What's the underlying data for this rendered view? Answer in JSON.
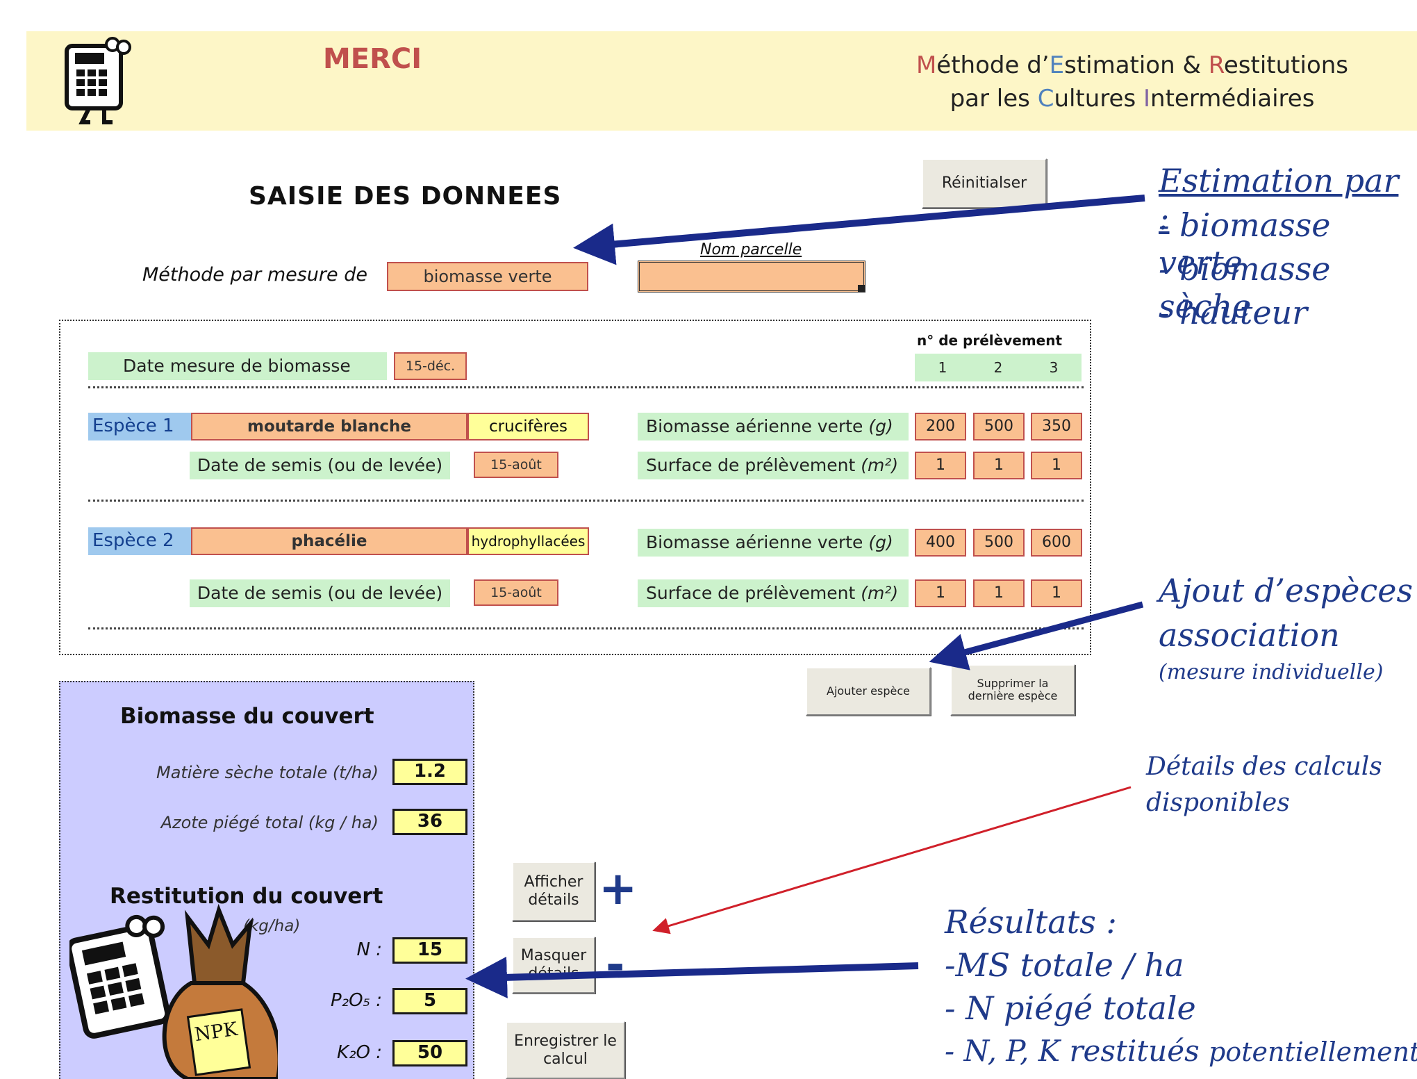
{
  "header": {
    "app_name": "MERCI",
    "subtitle_parts": [
      "M",
      "éthode d’",
      "E",
      "stimation & ",
      "R",
      "estitutions"
    ],
    "subtitle_line2_parts": [
      "par les ",
      "C",
      "ultures ",
      "I",
      "ntermédiaires"
    ]
  },
  "form": {
    "title": "SAISIE DES DONNEES",
    "reset_label": "Réinitialser",
    "method_label": "Méthode par mesure de",
    "method_value": "biomasse verte",
    "parcel_label": "Nom parcelle",
    "parcel_value": "",
    "date_biomass_label": "Date mesure de biomasse",
    "date_biomass_value": "15-déc.",
    "sample_header": "n° de prélèvement",
    "sample_numbers": [
      "1",
      "2",
      "3"
    ],
    "species": [
      {
        "label": "Espèce 1",
        "name": "moutarde blanche",
        "family": "crucifères",
        "sowing_label": "Date de semis (ou de levée)",
        "sowing_date": "15-août",
        "biomass_label": "Biomasse aérienne verte",
        "biomass_unit": "(g)",
        "biomass_values": [
          "200",
          "500",
          "350"
        ],
        "surface_label": "Surface de prélèvement",
        "surface_unit": "(m²)",
        "surface_values": [
          "1",
          "1",
          "1"
        ]
      },
      {
        "label": "Espèce 2",
        "name": "phacélie",
        "family": "hydrophyllacées",
        "sowing_label": "Date de semis (ou de levée)",
        "sowing_date": "15-août",
        "biomass_label": "Biomasse aérienne verte",
        "biomass_unit": "(g)",
        "biomass_values": [
          "400",
          "500",
          "600"
        ],
        "surface_label": "Surface de prélèvement",
        "surface_unit": "(m²)",
        "surface_values": [
          "1",
          "1",
          "1"
        ]
      }
    ],
    "add_species_label": "Ajouter espèce",
    "remove_species_label": "Supprimer la dernière espèce"
  },
  "results": {
    "biomass_title": "Biomasse du couvert",
    "dry_matter_label": "Matière sèche totale (t/ha)",
    "dry_matter_value": "1.2",
    "nitrogen_label": "Azote piégé total (kg / ha)",
    "nitrogen_value": "36",
    "restitution_title": "Restitution du couvert",
    "restitution_unit": "(kg/ha)",
    "n_label": "N :",
    "n_value": "15",
    "p_label": "P₂O₅ :",
    "p_value": "5",
    "k_label": "K₂O :",
    "k_value": "50",
    "npk_bag_text": "NPK"
  },
  "actions": {
    "show_details": "Afficher détails",
    "hide_details": "Masquer détails",
    "save_calc": "Enregistrer le calcul",
    "plus_glyph": "+",
    "minus_glyph": "-"
  },
  "annotations": {
    "estimation_title": "Estimation par :",
    "estimation_items": [
      "- biomasse verte",
      "- biomasse sèche",
      "- hauteur"
    ],
    "add_species_line1": "Ajout d’espèces si",
    "add_species_line2": "association",
    "add_species_line3": "(mesure individuelle)",
    "details_line1": "Détails des calculs",
    "details_line2": "disponibles",
    "results_title": "Résultats :",
    "results_items": [
      "-MS totale / ha",
      "-  N piégé totale",
      "- N, P, K restitués"
    ],
    "results_last_suffix": "potentiellement"
  },
  "colors": {
    "header_bg": "#fdf6c7",
    "input_orange": "#fac090",
    "label_green": "#ccf2cc",
    "species_blue": "#9fc9ee",
    "result_panel": "#ccccff",
    "annotation_blue": "#1f3a8a",
    "arrow_red": "#d0202a"
  }
}
